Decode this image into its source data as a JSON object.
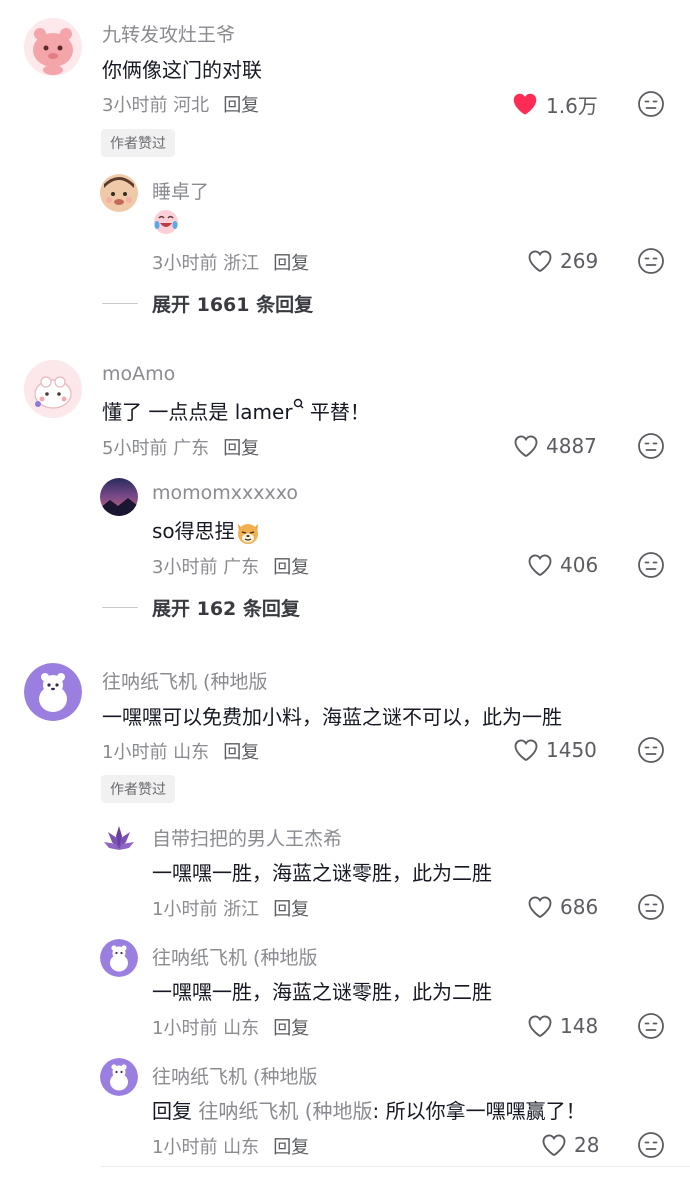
{
  "comments": [
    {
      "name": "九转发攻灶王爷",
      "text": "你俩像这门的对联",
      "time": "3小时前 河北",
      "reply_label": "回复",
      "likes": "1.6万",
      "liked": true,
      "author_badge": "作者赞过",
      "replies": [
        {
          "name": "睡卓了",
          "text": "",
          "emoji": "crying-laughing",
          "time": "3小时前 浙江",
          "reply_label": "回复",
          "likes": "269"
        }
      ],
      "expand": "展开 1661 条回复"
    },
    {
      "name": "moAmo",
      "text_before": "懂了 一点点是 ",
      "text_link": "lamer",
      "text_after": " 平替！",
      "time": "5小时前 广东",
      "reply_label": "回复",
      "likes": "4887",
      "replies": [
        {
          "name": "momomxxxxxo",
          "text": "so得思捏",
          "emoji": "shiba-dog",
          "time": "3小时前 广东",
          "reply_label": "回复",
          "likes": "406"
        }
      ],
      "expand": "展开 162 条回复"
    },
    {
      "name": "往呐纸飞机 (种地版",
      "text": "一嘿嘿可以免费加小料，海蓝之谜不可以，此为一胜",
      "time": "1小时前 山东",
      "reply_label": "回复",
      "likes": "1450",
      "author_badge": "作者赞过",
      "replies": [
        {
          "name": "自带扫把的男人王杰希",
          "text": "一嘿嘿一胜，海蓝之谜零胜，此为二胜",
          "time": "1小时前 浙江",
          "reply_label": "回复",
          "likes": "686"
        },
        {
          "name": "往呐纸飞机 (种地版",
          "text": "一嘿嘿一胜，海蓝之谜零胜，此为二胜",
          "time": "1小时前 山东",
          "reply_label": "回复",
          "likes": "148"
        },
        {
          "name": "往呐纸飞机 (种地版",
          "reply_prefix": "回复",
          "reply_to": "往呐纸飞机 (种地版",
          "text": ": 所以你拿一嘿嘿赢了！",
          "time": "1小时前 山东",
          "reply_label": "回复",
          "likes": "28"
        }
      ]
    }
  ],
  "colors": {
    "like_red": "#fe2c55",
    "text": "#161823",
    "muted": "#8a8b91"
  }
}
